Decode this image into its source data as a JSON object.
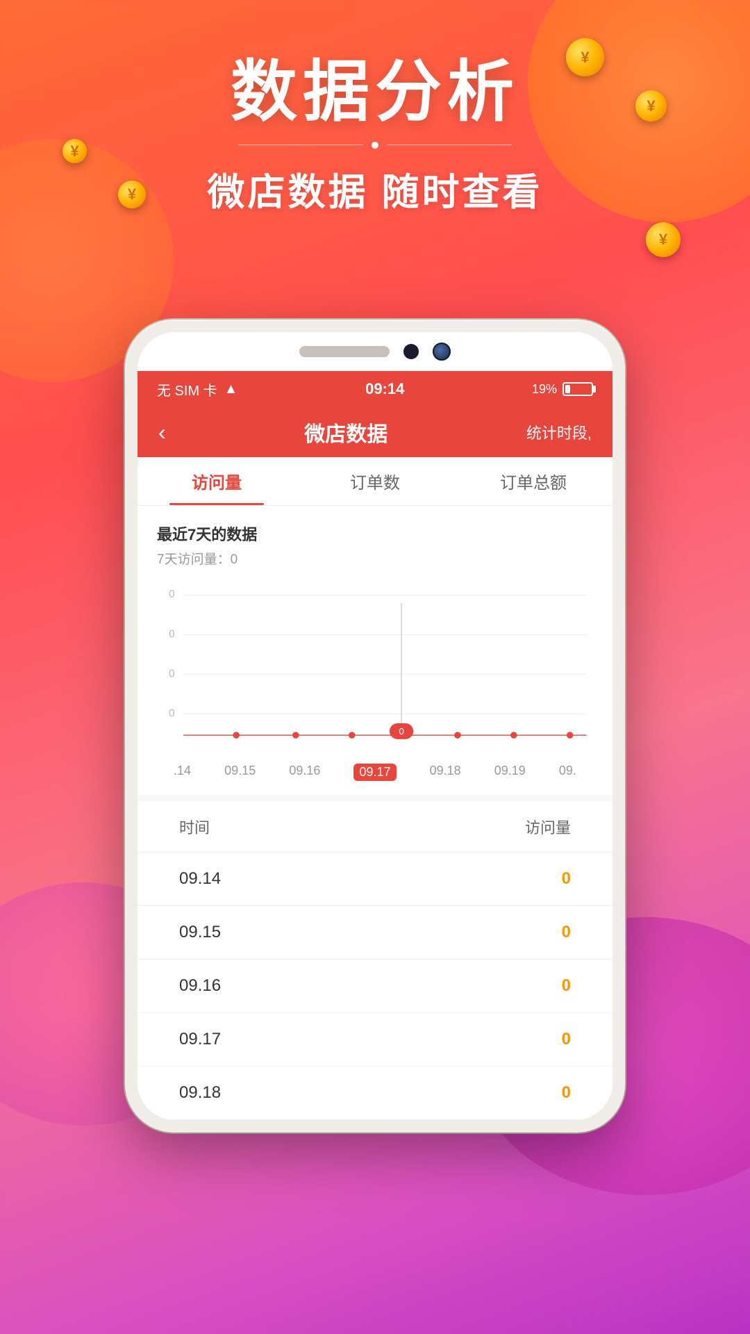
{
  "background": {
    "gradient_start": "#ff6b35",
    "gradient_end": "#b833c4"
  },
  "header": {
    "main_title": "数据分析",
    "sub_title": "微店数据 随时查看"
  },
  "status_bar": {
    "carrier": "无 SIM 卡",
    "wifi": "WiFi",
    "time": "09:14",
    "battery_percent": "19%"
  },
  "nav": {
    "back_label": "‹",
    "title": "微店数据",
    "right_label": "统计时段,"
  },
  "tabs": [
    {
      "label": "访问量",
      "active": true
    },
    {
      "label": "订单数",
      "active": false
    },
    {
      "label": "订单总额",
      "active": false
    }
  ],
  "chart": {
    "title": "最近7天的数据",
    "subtitle": "7天访问量：0",
    "y_labels": [
      "0",
      "0",
      "0",
      "0"
    ],
    "dates": [
      ".14",
      "09.15",
      "09.16",
      "09.17",
      "09.18",
      "09.19",
      "09."
    ],
    "active_date": "09.17",
    "active_value": "0",
    "data_points": [
      0,
      0,
      0,
      0,
      0,
      0,
      0
    ]
  },
  "table": {
    "col_time": "时间",
    "col_visits": "访问量",
    "rows": [
      {
        "date": "09.14",
        "value": "0"
      },
      {
        "date": "09.15",
        "value": "0"
      },
      {
        "date": "09.16",
        "value": "0"
      },
      {
        "date": "09.17",
        "value": "0"
      },
      {
        "date": "09.18",
        "value": "0"
      }
    ]
  }
}
